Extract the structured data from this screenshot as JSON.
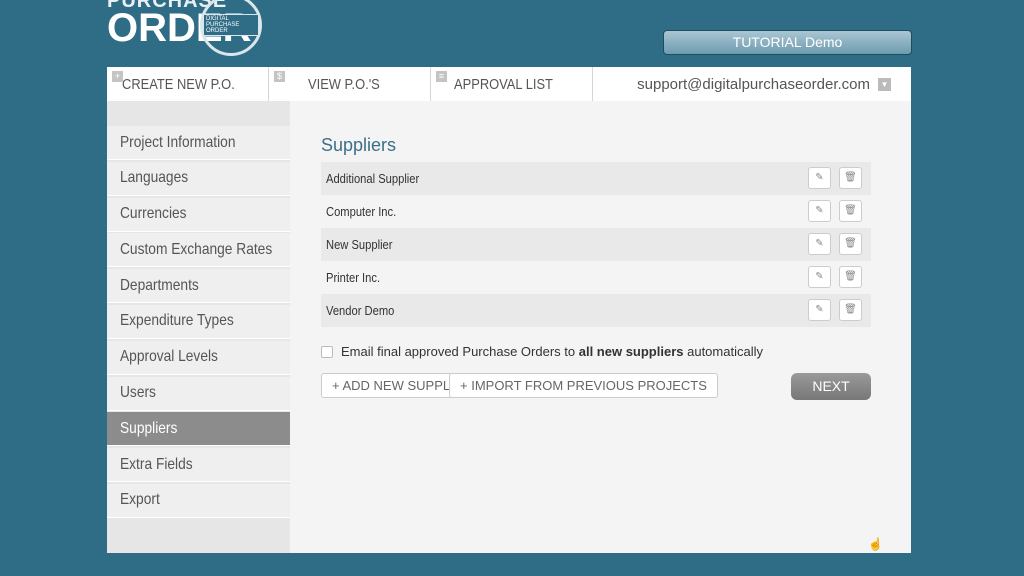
{
  "logo": {
    "line1": "PURCHASE",
    "line2": "ORDER",
    "seal": "DIGITAL PURCHASE ORDER"
  },
  "tutorial": "TUTORIAL Demo",
  "nav": {
    "tabs": [
      {
        "label": "CREATE NEW P.O.",
        "icon": "plus-icon"
      },
      {
        "label": "VIEW P.O.'S",
        "icon": "dollar-icon"
      },
      {
        "label": "APPROVAL LIST",
        "icon": "list-icon"
      }
    ],
    "user": "support@digitalpurchaseorder.com"
  },
  "sidebar": {
    "items": [
      "Project Information",
      "Languages",
      "Currencies",
      "Custom Exchange Rates",
      "Departments",
      "Expenditure Types",
      "Approval Levels",
      "Users",
      "Suppliers",
      "Extra Fields",
      "Export"
    ],
    "active": "Suppliers"
  },
  "main": {
    "title": "Suppliers",
    "suppliers": [
      "Additional Supplier",
      "Computer Inc.",
      "New Supplier",
      "Printer Inc.",
      "Vendor Demo"
    ],
    "email_pre": "Email final approved Purchase Orders to ",
    "email_bold": "all new suppliers",
    "email_post": " automatically",
    "add_label": "+ ADD NEW SUPPLIER",
    "import_label": "+ IMPORT FROM PREVIOUS PROJECTS",
    "next_label": "NEXT"
  },
  "colors": {
    "background": "#2f6c85",
    "accent": "#3c6f89",
    "active_item": "#8c8c8c"
  }
}
